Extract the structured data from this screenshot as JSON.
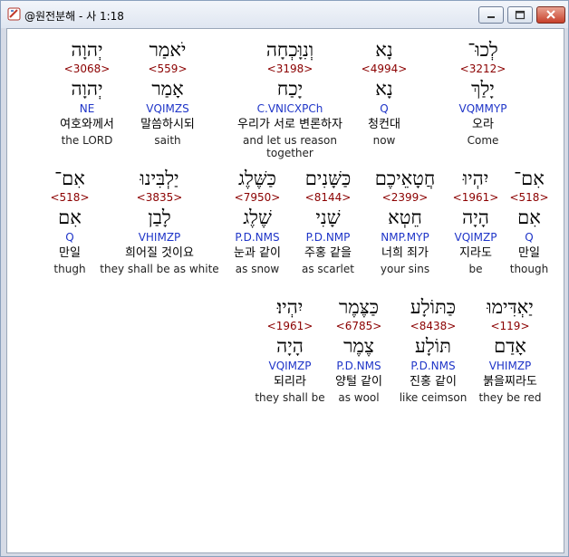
{
  "window": {
    "title": "@원전분해 - 사 1:18"
  },
  "rows": [
    [
      {
        "hebrew": "יְהוָה",
        "number": "<3068>",
        "lemma": "יְהוָה",
        "morph": "NE",
        "korean": "여호와께서",
        "english": "the LORD"
      },
      {
        "hebrew": "יֹאמַר",
        "number": "<559>",
        "lemma": "אָמַר",
        "morph": "VQIMZS",
        "korean": "말씀하시되",
        "english": "saith"
      },
      {
        "hebrew": "וְנִוָּכְחָה",
        "number": "<3198>",
        "lemma": "יָכַח",
        "morph": "C.VNICXPCh",
        "korean": "우리가 서로 변론하자",
        "english": "and let us reason together"
      },
      {
        "hebrew": "נָא",
        "number": "<4994>",
        "lemma": "נָא",
        "morph": "Q",
        "korean": "청컨대",
        "english": "now"
      },
      {
        "hebrew": "לְכוּ־",
        "number": "<3212>",
        "lemma": "יָלַךְ",
        "morph": "VQMMYP",
        "korean": "오라",
        "english": "Come"
      }
    ],
    [
      {
        "hebrew": "אִם־",
        "number": "<518>",
        "lemma": "אִם",
        "morph": "Q",
        "korean": "만일",
        "english": "thugh"
      },
      {
        "hebrew": "יַלְבִּינוּ",
        "number": "<3835>",
        "lemma": "לָבַן",
        "morph": "VHIMZP",
        "korean": "희어질 것이요",
        "english": "they shall be as white"
      },
      {
        "hebrew": "כַּשֶּׁלֶג",
        "number": "<7950>",
        "lemma": "שֶׁלֶג",
        "morph": "P.D.NMS",
        "korean": "눈과 같이",
        "english": "as snow"
      },
      {
        "hebrew": "כַּשָּׁנִים",
        "number": "<8144>",
        "lemma": "שָׁנִי",
        "morph": "P.D.NMP",
        "korean": "주홍 같을",
        "english": "as scarlet"
      },
      {
        "hebrew": "חֲטָאֵיכֶם",
        "number": "<2399>",
        "lemma": "חֵטְא",
        "morph": "NMP.MYP",
        "korean": "너희 죄가",
        "english": "your sins"
      },
      {
        "hebrew": "יִהְיוּ",
        "number": "<1961>",
        "lemma": "הָיָה",
        "morph": "VQIMZP",
        "korean": "지라도",
        "english": "be"
      },
      {
        "hebrew": "אִם־",
        "number": "<518>",
        "lemma": "אִם",
        "morph": "Q",
        "korean": "만일",
        "english": "though"
      }
    ],
    [
      {
        "hebrew": "יִהְיוּ׃",
        "number": "<1961>",
        "lemma": "הָיָה",
        "morph": "VQIMZP",
        "korean": "되리라",
        "english": "they shall be"
      },
      {
        "hebrew": "כַּצֶּמֶר",
        "number": "<6785>",
        "lemma": "צֶמֶר",
        "morph": "P.D.NMS",
        "korean": "양털 같이",
        "english": "as wool"
      },
      {
        "hebrew": "כַּתּוֹלָע",
        "number": "<8438>",
        "lemma": "תּוֹלָע",
        "morph": "P.D.NMS",
        "korean": "진홍 같이",
        "english": "like ceimson"
      },
      {
        "hebrew": "יַאְדִּימוּ",
        "number": "<119>",
        "lemma": "אָדַם",
        "morph": "VHIMZP",
        "korean": "붉을찌라도",
        "english": "they be red"
      }
    ]
  ],
  "colors": {
    "number": "#8b0000",
    "morph": "#1f35c8",
    "close_button": "#c7402b"
  },
  "icons": {
    "app": "app-icon",
    "minimize": "minimize-icon",
    "maximize": "maximize-icon",
    "close": "close-icon"
  }
}
